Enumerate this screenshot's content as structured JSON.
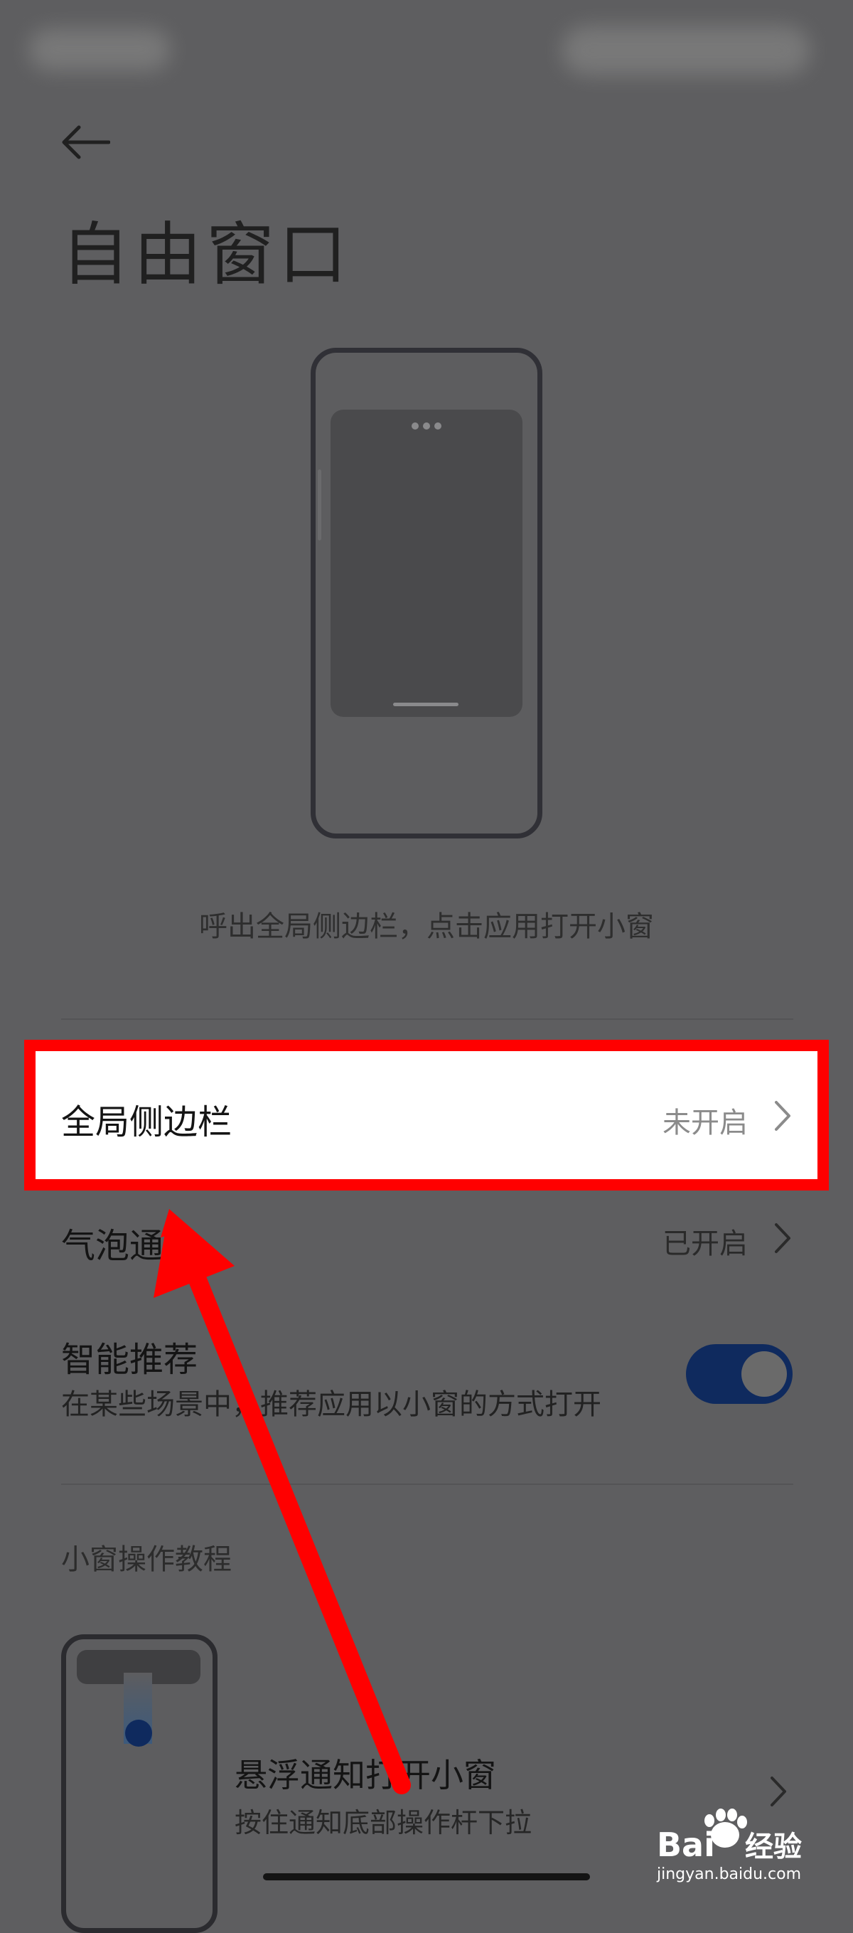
{
  "page": {
    "title": "自由窗口",
    "caption": "呼出全局侧边栏，点击应用打开小窗"
  },
  "rows": {
    "global_sidebar": {
      "label": "全局侧边栏",
      "status": "未开启"
    },
    "bubble_notification": {
      "label": "气泡通知",
      "status": "已开启"
    },
    "smart_recommend": {
      "label": "智能推荐",
      "description": "在某些场景中，推荐应用以小窗的方式打开",
      "enabled": true
    }
  },
  "tutorial": {
    "section_label": "小窗操作教程",
    "items": [
      {
        "title": "悬浮通知打开小窗",
        "subtitle": "按住通知底部操作杆下拉"
      }
    ]
  },
  "watermark": {
    "brand": "Baidu经验",
    "url": "jingyan.baidu.com"
  },
  "colors": {
    "highlight_border": "#ff0000",
    "toggle_on": "#0f2a5e",
    "annotation_arrow": "#ff0000"
  },
  "icons": [
    "back-arrow-icon",
    "chevron-right-icon",
    "toggle-switch",
    "annotation-arrow",
    "baidu-paw-icon"
  ]
}
